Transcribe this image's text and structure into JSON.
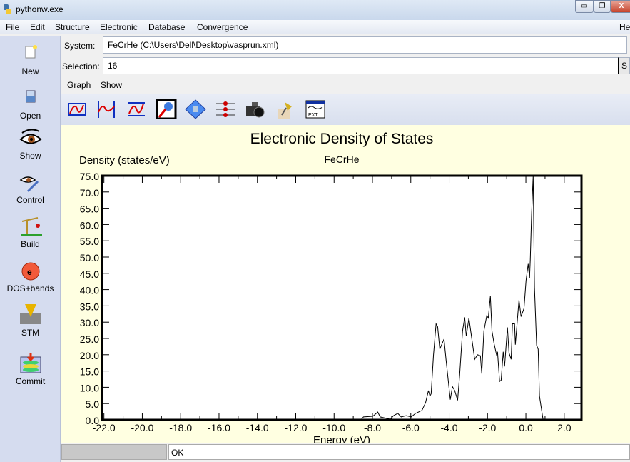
{
  "window": {
    "title": "pythonw.exe",
    "minimize": "▭",
    "maximize": "❐",
    "close": "X"
  },
  "menu": [
    "File",
    "Edit",
    "Structure",
    "Electronic",
    "Database",
    "Convergence"
  ],
  "menu_right": "He",
  "sidebar": [
    {
      "label": "New",
      "icon": "new-file-icon"
    },
    {
      "label": "Open",
      "icon": "open-icon"
    },
    {
      "label": "Show",
      "icon": "eye-icon"
    },
    {
      "label": "Control",
      "icon": "eye-wrench-icon"
    },
    {
      "label": "Build",
      "icon": "crane-icon"
    },
    {
      "label": "DOS+bands",
      "icon": "electron-icon"
    },
    {
      "label": "STM",
      "icon": "stm-tip-icon"
    },
    {
      "label": "Commit",
      "icon": "database-commit-icon"
    }
  ],
  "system": {
    "label": "System:",
    "value": "FeCrHe (C:\\Users\\Dell\\Desktop\\vasprun.xml)"
  },
  "selection": {
    "label": "Selection:",
    "value": "16",
    "button": "S"
  },
  "tabs": [
    "Graph",
    "Show"
  ],
  "toolbar": [
    "plot-frame-icon",
    "peak-markers-icon",
    "range-icon",
    "zoom-icon",
    "pan-icon",
    "series-icon",
    "camera-icon",
    "pushpin-icon",
    "export-icon"
  ],
  "status": {
    "text": "OK",
    "progress": 0
  },
  "chart_data": {
    "type": "line",
    "title": "Electronic Density of States",
    "subtitle": "FeCrHe",
    "xlabel": "Energy (eV)",
    "ylabel": "Density (states/eV)",
    "xlim": [
      -22.1,
      2.9
    ],
    "ylim": [
      0,
      75
    ],
    "xticks": [
      "-22.0",
      "-20.0",
      "-18.0",
      "-16.0",
      "-14.0",
      "-12.0",
      "-10.0",
      "-8.0",
      "-6.0",
      "-4.0",
      "-2.0",
      "0.0",
      "2.0"
    ],
    "yticks": [
      "0.0",
      "5.0",
      "10.0",
      "15.0",
      "20.0",
      "25.0",
      "30.0",
      "35.0",
      "40.0",
      "45.0",
      "50.0",
      "55.0",
      "60.0",
      "65.0",
      "70.0",
      "75.0"
    ],
    "grid": false,
    "x": [
      -22.1,
      -8.6,
      -8.47,
      -7.98,
      -7.72,
      -7.6,
      -7.06,
      -6.9,
      -6.68,
      -6.5,
      -6.24,
      -5.98,
      -5.75,
      -5.42,
      -5.23,
      -5.08,
      -5.0,
      -4.94,
      -4.82,
      -4.68,
      -4.6,
      -4.49,
      -4.27,
      -4.16,
      -3.94,
      -3.83,
      -3.71,
      -3.56,
      -3.45,
      -3.3,
      -3.19,
      -3.11,
      -2.97,
      -2.82,
      -2.67,
      -2.52,
      -2.37,
      -2.3,
      -2.19,
      -2.04,
      -1.96,
      -1.85,
      -1.77,
      -1.66,
      -1.52,
      -1.48,
      -1.37,
      -1.29,
      -1.18,
      -1.11,
      -0.96,
      -0.88,
      -0.77,
      -0.7,
      -0.59,
      -0.55,
      -0.36,
      -0.25,
      -0.1,
      0.01,
      0.12,
      0.19,
      0.23,
      0.3,
      0.38,
      0.45,
      0.56,
      0.64,
      0.71,
      0.9
    ],
    "y": [
      0,
      0,
      0.9,
      1.1,
      2.4,
      0.9,
      0.2,
      1.3,
      2,
      0.9,
      1.3,
      0.9,
      2,
      2.9,
      5.3,
      9,
      7.3,
      8,
      19.7,
      29.5,
      28.6,
      21.7,
      24.8,
      18.4,
      6.2,
      10.2,
      9,
      6,
      14,
      27.3,
      31.5,
      25.7,
      31.3,
      25,
      18.6,
      20,
      19.7,
      14.2,
      27.3,
      32,
      31.3,
      38,
      27.3,
      23.5,
      19.7,
      20.9,
      11.8,
      12.2,
      20.9,
      16.4,
      28.4,
      20.6,
      18.6,
      29.5,
      29.5,
      23.1,
      36.8,
      31.7,
      34.2,
      42.8,
      47.9,
      43.5,
      49,
      63.5,
      75,
      40.6,
      22.9,
      21.7,
      7.3,
      0
    ]
  }
}
